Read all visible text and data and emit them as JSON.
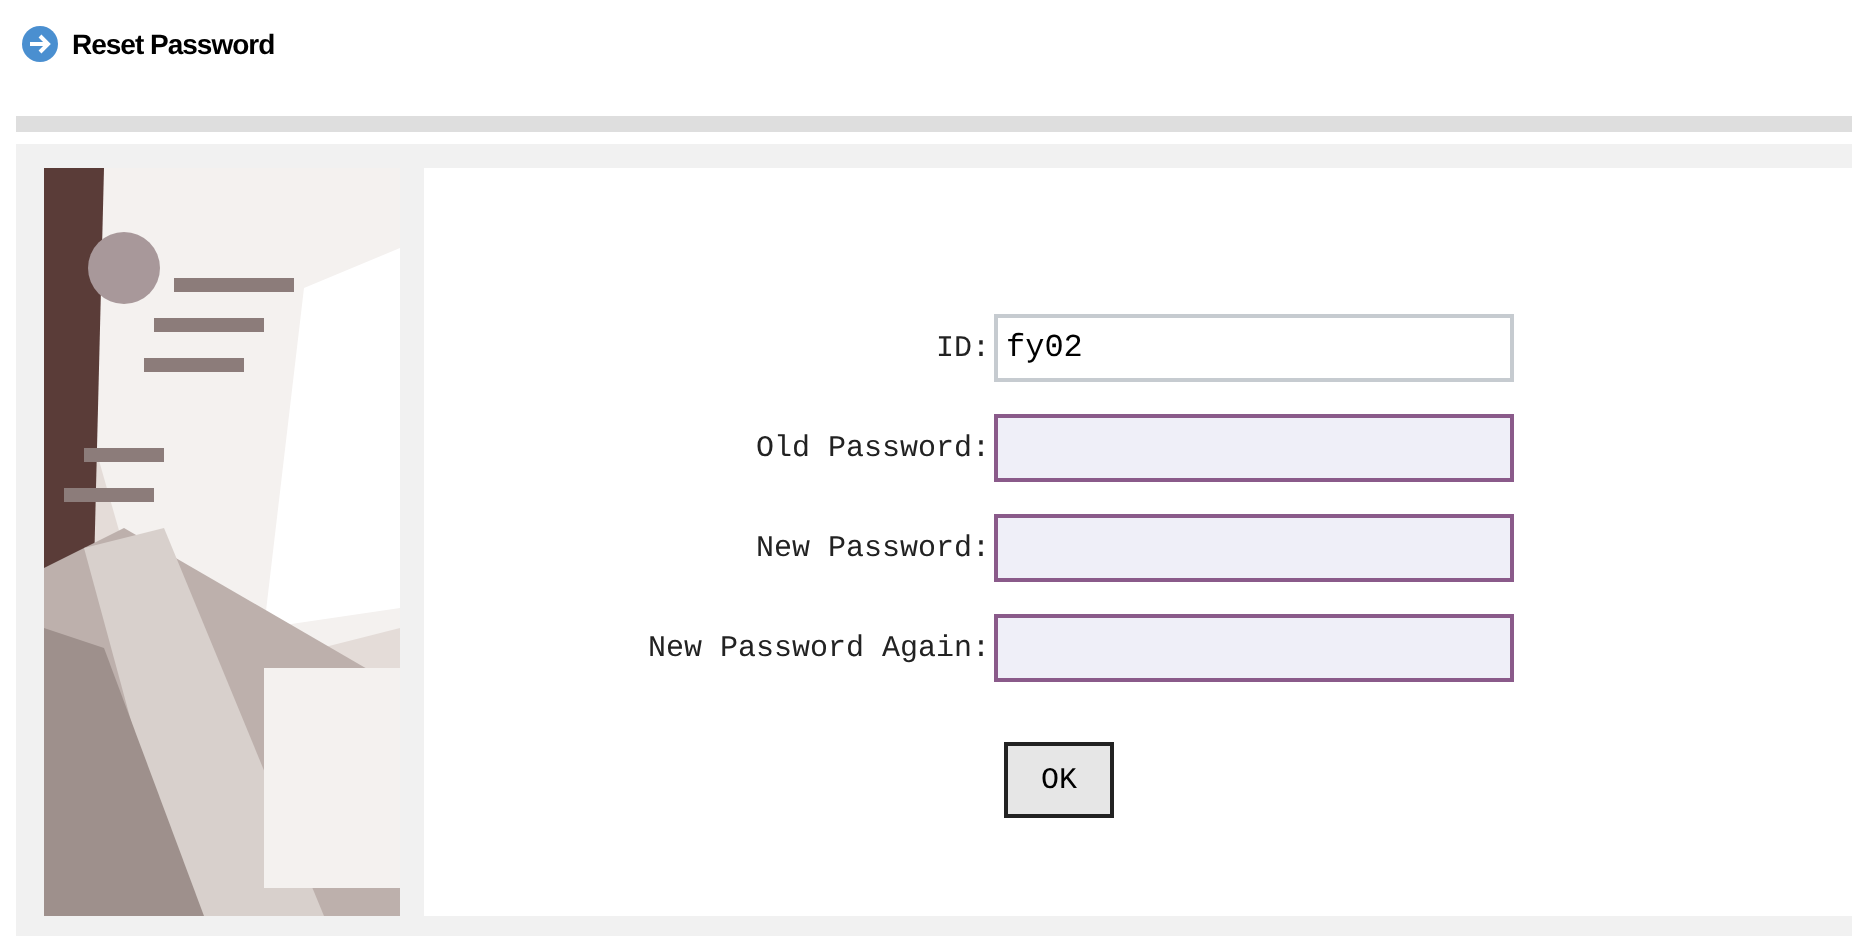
{
  "page_title": "Reset Password",
  "fields": [
    {
      "label": "ID:",
      "kind": "text",
      "value": "fy02"
    },
    {
      "label": "Old Password:",
      "kind": "password"
    },
    {
      "label": "New Password:",
      "kind": "password"
    },
    {
      "label": "New Password Again:",
      "kind": "password"
    }
  ],
  "button": "OK"
}
